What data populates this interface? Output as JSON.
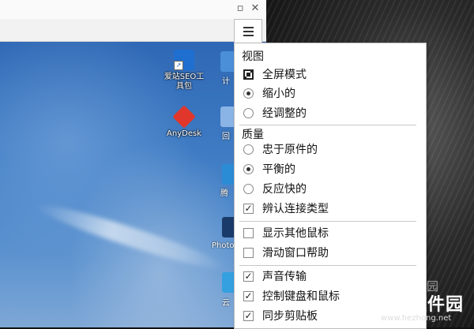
{
  "window": {
    "controls": {
      "minimize": "▫",
      "close": "✕"
    }
  },
  "desktop_icons": [
    {
      "label": "爱站SEO工\n具包",
      "color": "#1f6fd0"
    },
    {
      "label": "AnyDesk",
      "color": "#e0362b"
    }
  ],
  "partial_labels": [
    "计",
    "回",
    "腾",
    "Photo",
    "云"
  ],
  "menu": {
    "view_header": "视图",
    "fullscreen": "全屏模式",
    "view_options": [
      {
        "label": "缩小的",
        "selected": true
      },
      {
        "label": "经调整的",
        "selected": false
      }
    ],
    "quality_header": "质量",
    "quality_options": [
      {
        "label": "忠于原件的",
        "selected": false
      },
      {
        "label": "平衡的",
        "selected": true
      },
      {
        "label": "反应快的",
        "selected": false
      }
    ],
    "detect_connection": {
      "label": "辨认连接类型",
      "checked": true
    },
    "group2": [
      {
        "label": "显示其他鼠标",
        "checked": false
      },
      {
        "label": "滑动窗口帮助",
        "checked": false
      }
    ],
    "group3": [
      {
        "label": "声音传输",
        "checked": true
      },
      {
        "label": "控制键盘和鼠标",
        "checked": true
      },
      {
        "label": "同步剪贴板",
        "checked": true
      }
    ]
  },
  "watermark": {
    "line1": "当下软件园",
    "line2": "合众软件园",
    "line3": "www.hezhong.net"
  }
}
